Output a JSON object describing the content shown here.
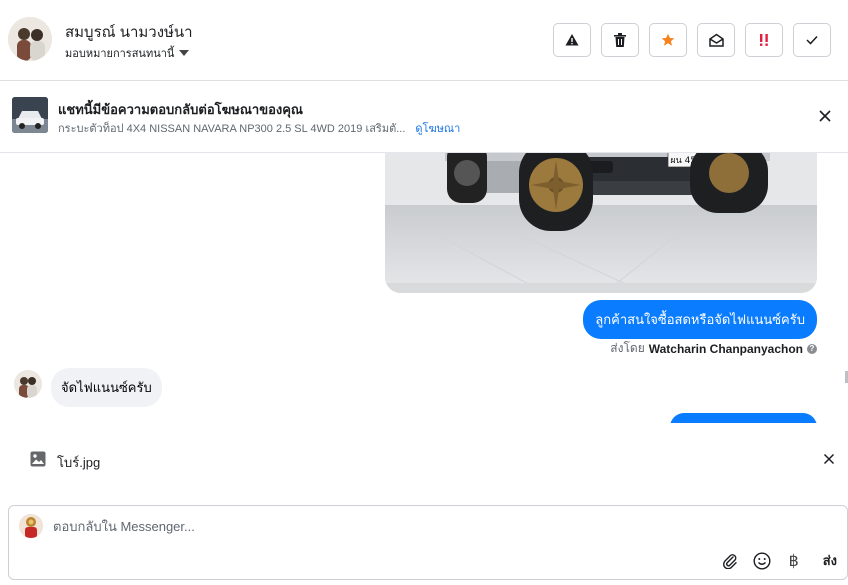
{
  "header": {
    "contact_name": "สมบูรณ์ นามวงษ์นา",
    "assign_label": "มอบหมายการสนทนานี้",
    "actions": [
      {
        "name": "spam-button",
        "icon": "warning-icon"
      },
      {
        "name": "delete-button",
        "icon": "trash-icon"
      },
      {
        "name": "star-button",
        "icon": "star-icon",
        "color": "#f5821f"
      },
      {
        "name": "mark-unread-button",
        "icon": "envelope-open-icon"
      },
      {
        "name": "follow-up-button",
        "icon": "double-exclamation-icon",
        "color": "#e41e3f"
      },
      {
        "name": "done-button",
        "icon": "check-icon"
      }
    ]
  },
  "ad_banner": {
    "title": "แชทนี้มีข้อความตอบกลับต่อโฆษณาของคุณ",
    "subtitle": "กระบะตัวท็อป 4X4 NISSAN NAVARA NP300 2.5 SL 4WD 2019 เสริมตั...",
    "link_label": "ดูโฆษณา"
  },
  "chat": {
    "photo_plate": "ผน 4514",
    "outgoing_1": "ลูกค้าสนใจซื้อสดหรือจัดไฟแนนซ์ครับ",
    "sent_by_prefix": "ส่งโดย",
    "sent_by_name": "Watcharin Chanpanyachon",
    "incoming_1": "จัดไฟแนนซ์ครับ"
  },
  "attachment": {
    "file_name": "โบร์.jpg"
  },
  "composer": {
    "placeholder": "ตอบกลับใน Messenger...",
    "send_label": "ส่ง",
    "currency_symbol": "฿"
  },
  "colors": {
    "accent": "#0a7cff",
    "link": "#1b74e4",
    "star": "#f5821f",
    "urgent": "#e41e3f"
  }
}
